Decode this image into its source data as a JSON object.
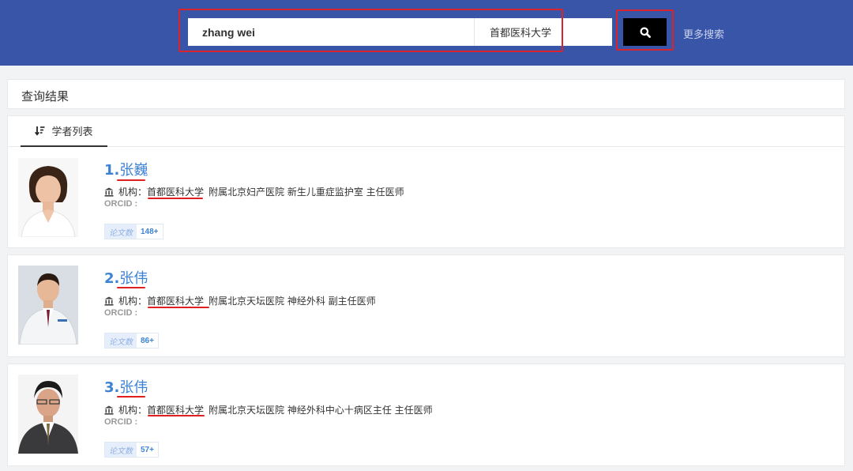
{
  "search": {
    "query": "zhang wei",
    "institution": "首都医科大学",
    "more_label": "更多搜索"
  },
  "results": {
    "title": "查询结果",
    "tab_label": "学者列表"
  },
  "scholars": [
    {
      "index": "1.",
      "name": "张巍",
      "inst_label": "机构：",
      "university": "首都医科大学",
      "affiliation": "附属北京妇产医院 新生儿重症监护室 主任医师",
      "orcid": "ORCID :",
      "papers_label": "论文数",
      "papers": "148+"
    },
    {
      "index": "2.",
      "name": "张伟",
      "inst_label": "机构：",
      "university": "首都医科大学",
      "affiliation": "附属北京天坛医院 神经外科 副主任医师",
      "orcid": "ORCID :",
      "papers_label": "论文数",
      "papers": "86+"
    },
    {
      "index": "3.",
      "name": "张伟",
      "inst_label": "机构：",
      "university": "首都医科大学",
      "affiliation": "附属北京天坛医院 神经外科中心十病区主任 主任医师",
      "orcid": "ORCID :",
      "papers_label": "论文数",
      "papers": "57+"
    }
  ],
  "colors": {
    "header_bg": "#3955a8",
    "link_blue": "#3d83d4",
    "highlight_red": "#d9232d"
  },
  "icons": {
    "search": "magnifier-icon",
    "sort": "sort-icon",
    "institution": "institution-icon"
  }
}
